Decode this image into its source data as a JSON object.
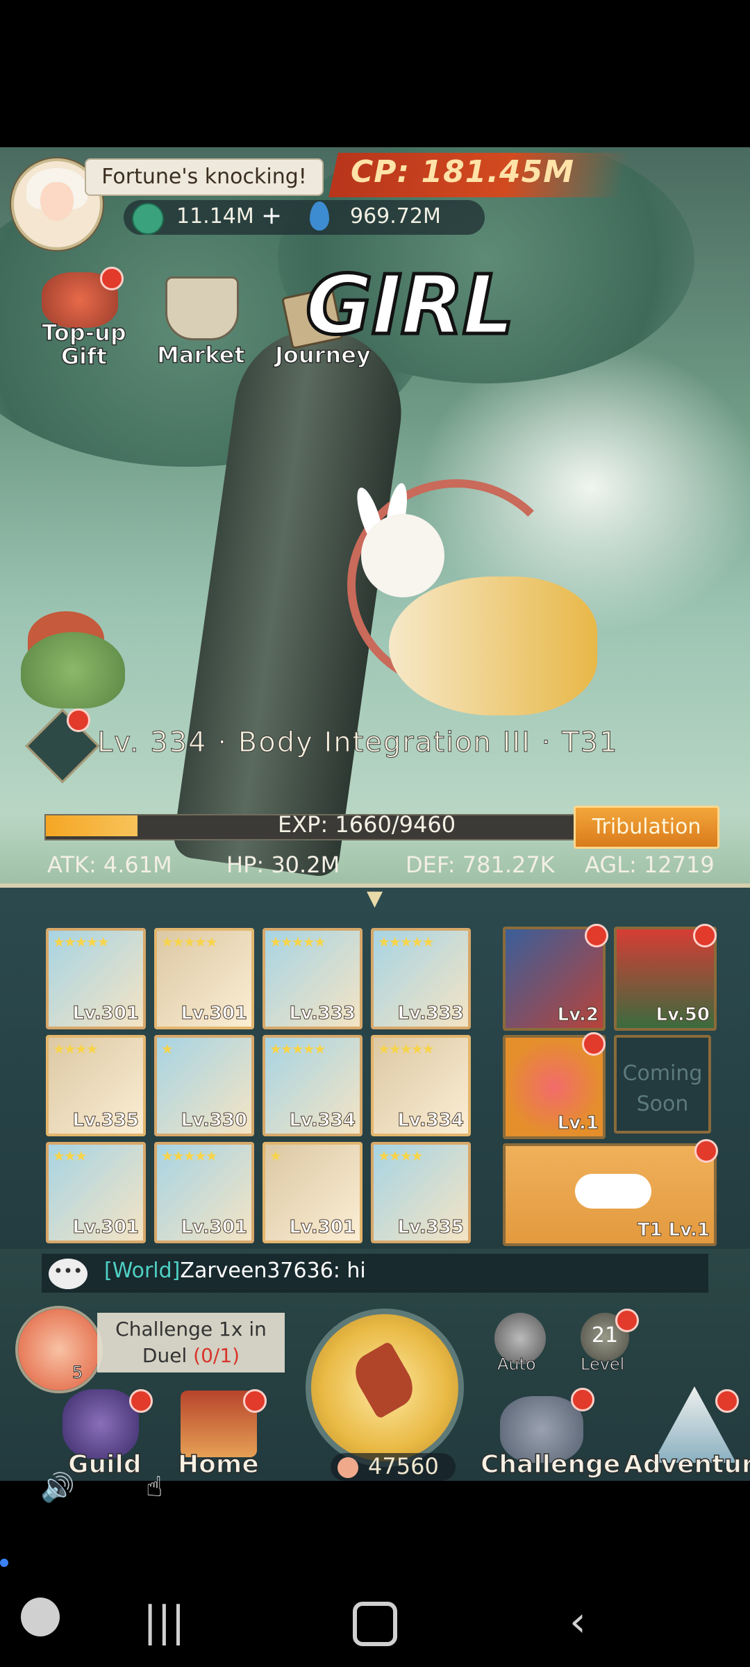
{
  "header": {
    "speech_bubble": "Fortune's knocking!",
    "cp_label": "CP: 181.45M",
    "currency_coins": "11.14M",
    "currency_plus": "+",
    "currency_gems": "969.72M"
  },
  "shortcuts": [
    {
      "label": "Top-up\nGift",
      "label_line1": "Top-up",
      "label_line2": "Gift"
    },
    {
      "label": "Market"
    },
    {
      "label": "Journey"
    }
  ],
  "overlay_text": "GIRL",
  "character": {
    "level_line": "Lv. 334 · Body Integration III · T31",
    "exp_text": "EXP: 1660/9460",
    "exp_progress": 0.175,
    "tribulation_label": "Tribulation",
    "stats": {
      "atk": "ATK: 4.61M",
      "hp": "HP: 30.2M",
      "def": "DEF: 781.27K",
      "agl": "AGL: 12719"
    }
  },
  "equipment": [
    {
      "lv": "Lv.301",
      "stars": "★★★★★"
    },
    {
      "lv": "Lv.301",
      "stars": "★★★★★"
    },
    {
      "lv": "Lv.333",
      "stars": "★★★★★"
    },
    {
      "lv": "Lv.333",
      "stars": "★★★★★"
    },
    {
      "lv": "Lv.335",
      "stars": "★★★★"
    },
    {
      "lv": "Lv.330",
      "stars": "★"
    },
    {
      "lv": "Lv.334",
      "stars": "★★★★★"
    },
    {
      "lv": "Lv.334",
      "stars": "★★★★★"
    },
    {
      "lv": "Lv.301",
      "stars": "★★★"
    },
    {
      "lv": "Lv.301",
      "stars": "★★★★★"
    },
    {
      "lv": "Lv.301",
      "stars": "★"
    },
    {
      "lv": "Lv.335",
      "stars": "★★★★"
    }
  ],
  "side_slots": {
    "dragon_lv": "Lv.2",
    "mushroom_lv": "Lv.50",
    "orb_lv": "Lv.1",
    "coming_soon": "Coming Soon",
    "cloud_lv": "T1 Lv.1"
  },
  "chat": {
    "channel": "[World]",
    "message": "Zarveen37636: hi",
    "icon_glyph": "•••"
  },
  "quest": {
    "text_line1": "Challenge 1x in",
    "text_line2": "Duel",
    "progress": "(0/1)",
    "peach_count": "5"
  },
  "actions": {
    "auto_label": "Auto",
    "level_label": "Level",
    "level_value": "21"
  },
  "bottom_nav": {
    "guild": "Guild",
    "home": "Home",
    "counter": "47560",
    "challenge": "Challenge",
    "adventure": "Adventure"
  },
  "colors": {
    "cp_banner": "#d24a1f",
    "exp_fill": "#f5a623",
    "tribulation": "#e8911f",
    "chat_channel": "#4fd1c5",
    "notify_dot": "#e23a2b",
    "quest_progress": "#d9342b"
  }
}
